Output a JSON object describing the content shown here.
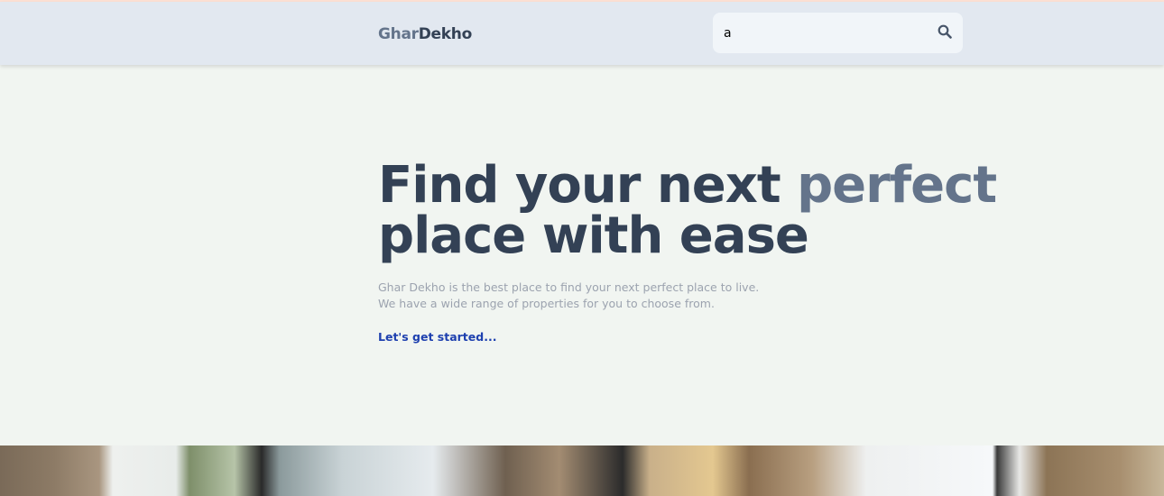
{
  "header": {
    "logo_part1": "Ghar",
    "logo_part2": "Dekho",
    "search_value": "a",
    "search_icon": "search-icon"
  },
  "hero": {
    "title_part1": "Find your next ",
    "title_highlight": "perfect",
    "title_part2": "place with ease",
    "subtitle_line1": "Ghar Dekho is the best place to find your next perfect place to live.",
    "subtitle_line2": "We have a wide range of properties for you to choose from.",
    "cta": "Let's get started..."
  },
  "colors": {
    "header_bg": "#e2e8f0",
    "title": "#334155",
    "highlight": "#64748b",
    "cta": "#1e40af"
  }
}
